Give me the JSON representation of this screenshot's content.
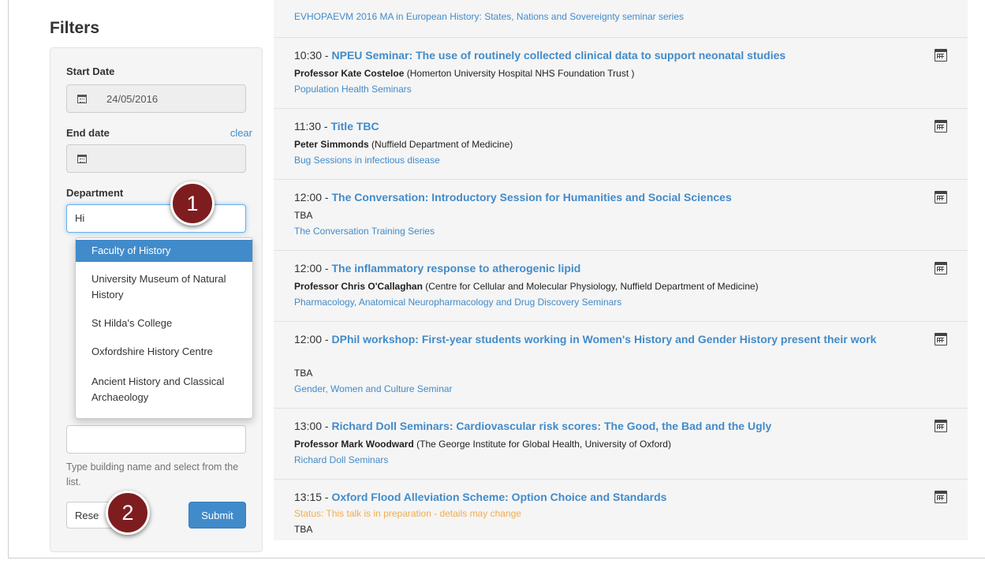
{
  "filters": {
    "title": "Filters",
    "start_date_label": "Start Date",
    "start_date_value": "24/05/2016",
    "end_date_label": "End date",
    "clear_label": "clear",
    "end_date_value": "",
    "department_label": "Department",
    "department_value": "Hi",
    "location_help": "Type building name and select from the list.",
    "reset_label": "Rese",
    "submit_label": "Submit"
  },
  "department_suggestions": [
    "Faculty of History",
    "University Museum of Natural History",
    "St Hilda's College",
    "Oxfordshire History Centre",
    "Ancient History and Classical Archaeology"
  ],
  "callouts": [
    "1",
    "2"
  ],
  "top_series": "EVHOPAEVM 2016 MA in European History: States, Nations and Sovereignty seminar series",
  "talks": [
    {
      "time": "10:30",
      "title": "NPEU Seminar: The use of routinely collected clinical data to support neonatal studies",
      "speaker": "Professor Kate Costeloe",
      "affiliation": "(Homerton University Hospital NHS Foundation Trust )",
      "series": "Population Health Seminars"
    },
    {
      "time": "11:30",
      "title": "Title TBC",
      "speaker": "Peter Simmonds",
      "affiliation": "(Nuffield Department of Medicine)",
      "series": "Bug Sessions in infectious disease"
    },
    {
      "time": "12:00",
      "title": "The Conversation: Introductory Session for Humanities and Social Sciences",
      "speaker": "TBA",
      "affiliation": "",
      "series": "The Conversation Training Series"
    },
    {
      "time": "12:00",
      "title": "The inflammatory response to atherogenic lipid",
      "speaker": "Professor Chris O'Callaghan",
      "affiliation": "(Centre for Cellular and Molecular Physiology, Nuffield Department of Medicine)",
      "series": "Pharmacology, Anatomical Neuropharmacology and Drug Discovery Seminars"
    },
    {
      "time": "12:00",
      "title": "DPhil workshop: First-year students working in Women's History and Gender History present their work",
      "speaker": "TBA",
      "affiliation": "",
      "series": "Gender, Women and Culture Seminar"
    },
    {
      "time": "13:00",
      "title": "Richard Doll Seminars: Cardiovascular risk scores: The Good, the Bad and the Ugly",
      "speaker": "Professor Mark Woodward",
      "affiliation": "(The George Institute for Global Health, University of Oxford)",
      "series": "Richard Doll Seminars"
    },
    {
      "time": "13:15",
      "title": "Oxford Flood Alleviation Scheme: Option Choice and Standards",
      "status_label": "Status:",
      "status_text": "This talk is in preparation - details may change",
      "speaker": "TBA"
    }
  ],
  "icons": {
    "calendar": "calendar-icon"
  },
  "colors": {
    "link": "#428bca",
    "callout": "#7e1d1f",
    "status": "#f0ad4e"
  }
}
